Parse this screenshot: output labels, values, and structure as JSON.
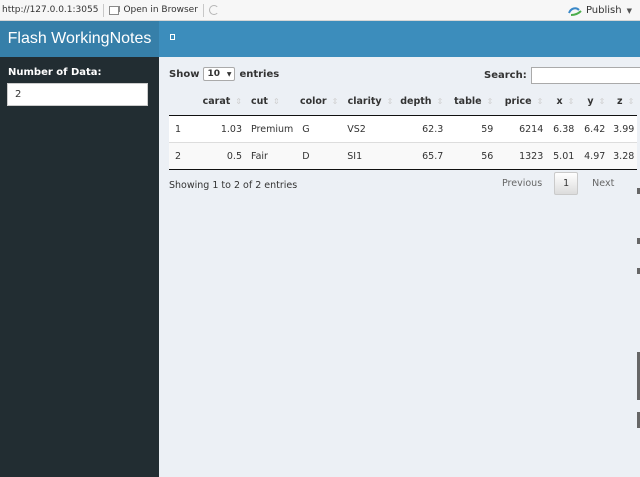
{
  "viewer": {
    "url": "http://127.0.0.1:3055",
    "open_in_browser": "Open in Browser",
    "publish": "Publish"
  },
  "header": {
    "title": "Flash WorkingNotes"
  },
  "sidebar": {
    "number_label": "Number of Data:",
    "number_value": "2"
  },
  "table_controls": {
    "show_prefix": "Show",
    "length_value": "10",
    "show_suffix": "entries",
    "search_label": "Search:",
    "search_value": ""
  },
  "table": {
    "columns": [
      "",
      "carat",
      "cut",
      "color",
      "clarity",
      "depth",
      "table",
      "price",
      "x",
      "y",
      "z"
    ],
    "rows": [
      [
        "1",
        "1.03",
        "Premium",
        "G",
        "VS2",
        "62.3",
        "59",
        "6214",
        "6.38",
        "6.42",
        "3.99"
      ],
      [
        "2",
        "0.5",
        "Fair",
        "D",
        "SI1",
        "65.7",
        "56",
        "1323",
        "5.01",
        "4.97",
        "3.28"
      ]
    ]
  },
  "footer": {
    "info": "Showing 1 to 2 of 2 entries",
    "previous": "Previous",
    "current_page": "1",
    "next": "Next"
  },
  "colors": {
    "navbar": "#3c8dbc",
    "logo": "#367fa9",
    "sidebar": "#222d32",
    "content_bg": "#ecf0f5"
  }
}
